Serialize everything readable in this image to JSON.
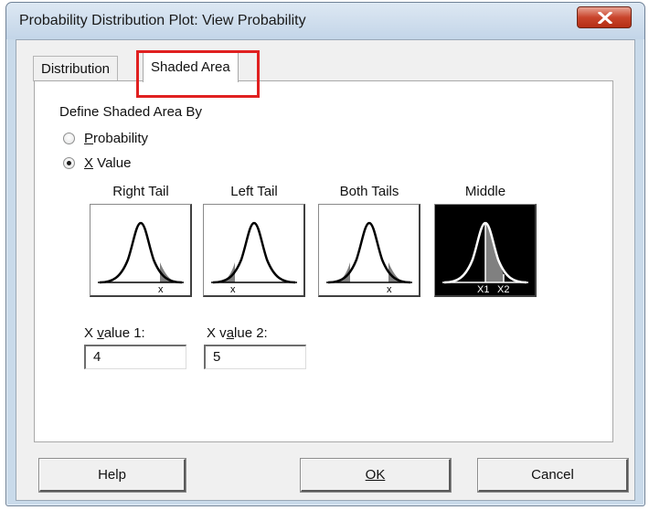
{
  "window": {
    "title": "Probability Distribution Plot: View Probability"
  },
  "tabs": [
    {
      "label": "Distribution",
      "active": false
    },
    {
      "label": "Shaded Area",
      "active": true
    }
  ],
  "panel": {
    "define_label": "Define Shaded Area By",
    "options": [
      {
        "prefix": "",
        "hotkey": "P",
        "rest": "robability",
        "checked": false
      },
      {
        "prefix": "",
        "hotkey": "X",
        "rest": " Value",
        "checked": true
      }
    ],
    "tails": [
      {
        "label": "Right Tail",
        "marker": "x",
        "selected": false
      },
      {
        "label": "Left Tail",
        "marker": "x",
        "selected": false
      },
      {
        "label": "Both Tails",
        "marker": "x",
        "selected": false
      },
      {
        "label": "Middle",
        "markers": [
          "X1",
          "X2"
        ],
        "selected": true
      }
    ],
    "x_value_1": {
      "label_pre": "X ",
      "label_hot": "v",
      "label_post": "alue 1:",
      "value": "4"
    },
    "x_value_2": {
      "label_pre": "X v",
      "label_hot": "a",
      "label_post": "lue 2:",
      "value": "5"
    }
  },
  "buttons": {
    "help": "Help",
    "ok": "OK",
    "cancel": "Cancel"
  },
  "colors": {
    "highlight": "#e02020",
    "shade": "#808080",
    "selected_bg": "#000000"
  }
}
